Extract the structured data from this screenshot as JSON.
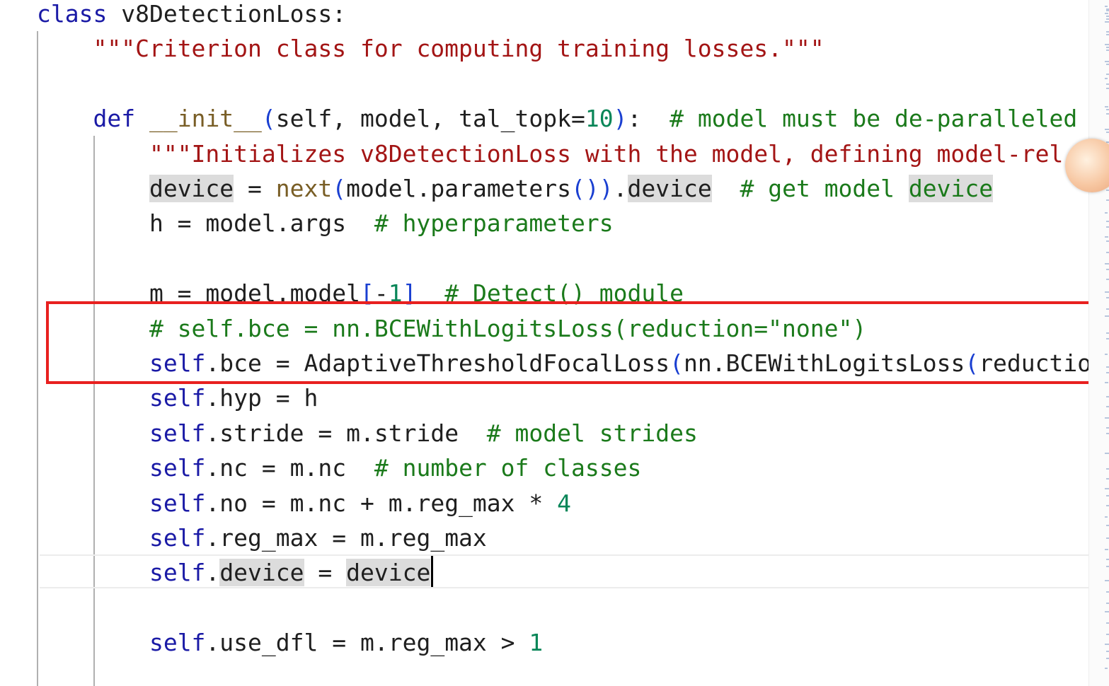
{
  "editor": {
    "lines": [
      {
        "id": "class-def",
        "tokens": [
          {
            "t": "class ",
            "c": "kw"
          },
          {
            "t": "v8DetectionLoss",
            "c": ""
          },
          {
            "t": ":",
            "c": ""
          }
        ]
      },
      {
        "id": "class-docstring",
        "tokens": [
          {
            "t": "    ",
            "c": ""
          },
          {
            "t": "\"\"\"Criterion class for computing training losses.\"\"\"",
            "c": "str"
          }
        ]
      },
      {
        "id": "blank-1",
        "tokens": []
      },
      {
        "id": "init-def",
        "tokens": [
          {
            "t": "    ",
            "c": ""
          },
          {
            "t": "def ",
            "c": "kw"
          },
          {
            "t": "__init__",
            "c": "fn"
          },
          {
            "t": "(",
            "c": "par"
          },
          {
            "t": "self, model, tal_topk=",
            "c": ""
          },
          {
            "t": "10",
            "c": "num"
          },
          {
            "t": ")",
            "c": "par"
          },
          {
            "t": ":  ",
            "c": ""
          },
          {
            "t": "# model must be de-paralleled",
            "c": "cmt"
          }
        ]
      },
      {
        "id": "init-docstring",
        "tokens": [
          {
            "t": "        ",
            "c": ""
          },
          {
            "t": "\"\"\"Initializes v8DetectionLoss with the model, defining model-rel",
            "c": "str"
          }
        ]
      },
      {
        "id": "device-assign",
        "tokens": [
          {
            "t": "        ",
            "c": ""
          },
          {
            "t": "device",
            "c": "hl"
          },
          {
            "t": " = ",
            "c": ""
          },
          {
            "t": "next",
            "c": "fn"
          },
          {
            "t": "(",
            "c": "par"
          },
          {
            "t": "model.parameters",
            "c": ""
          },
          {
            "t": "())",
            "c": "par"
          },
          {
            "t": ".",
            "c": ""
          },
          {
            "t": "device",
            "c": "hl"
          },
          {
            "t": "  ",
            "c": ""
          },
          {
            "t": "# get model ",
            "c": "cmt"
          },
          {
            "t": "device",
            "c": "cmt hl"
          }
        ]
      },
      {
        "id": "hyp-assign",
        "tokens": [
          {
            "t": "        h = model.args  ",
            "c": ""
          },
          {
            "t": "# hyperparameters",
            "c": "cmt"
          }
        ]
      },
      {
        "id": "blank-2",
        "tokens": []
      },
      {
        "id": "detect-module",
        "tokens": [
          {
            "t": "        m = model.model",
            "c": ""
          },
          {
            "t": "[",
            "c": "par"
          },
          {
            "t": "-",
            "c": ""
          },
          {
            "t": "1",
            "c": "num"
          },
          {
            "t": "]",
            "c": "par"
          },
          {
            "t": "  ",
            "c": ""
          },
          {
            "t": "# Detect() module",
            "c": "cmt"
          }
        ]
      },
      {
        "id": "bce-commented",
        "tokens": [
          {
            "t": "        ",
            "c": ""
          },
          {
            "t": "# self.bce = nn.BCEWithLogitsLoss(reduction=\"none\")",
            "c": "cmt"
          }
        ]
      },
      {
        "id": "bce-adaptive",
        "tokens": [
          {
            "t": "        ",
            "c": ""
          },
          {
            "t": "self",
            "c": "slf"
          },
          {
            "t": ".bce = AdaptiveThresholdFocalLoss",
            "c": ""
          },
          {
            "t": "(",
            "c": "par"
          },
          {
            "t": "nn.BCEWithLogitsLoss",
            "c": ""
          },
          {
            "t": "(",
            "c": "par"
          },
          {
            "t": "reductio",
            "c": ""
          }
        ]
      },
      {
        "id": "hyp-self",
        "tokens": [
          {
            "t": "        ",
            "c": ""
          },
          {
            "t": "self",
            "c": "slf"
          },
          {
            "t": ".hyp = h",
            "c": ""
          }
        ]
      },
      {
        "id": "stride",
        "tokens": [
          {
            "t": "        ",
            "c": ""
          },
          {
            "t": "self",
            "c": "slf"
          },
          {
            "t": ".stride = m.stride  ",
            "c": ""
          },
          {
            "t": "# model strides",
            "c": "cmt"
          }
        ]
      },
      {
        "id": "nc",
        "tokens": [
          {
            "t": "        ",
            "c": ""
          },
          {
            "t": "self",
            "c": "slf"
          },
          {
            "t": ".nc = m.nc  ",
            "c": ""
          },
          {
            "t": "# number of classes",
            "c": "cmt"
          }
        ]
      },
      {
        "id": "no",
        "tokens": [
          {
            "t": "        ",
            "c": ""
          },
          {
            "t": "self",
            "c": "slf"
          },
          {
            "t": ".no = m.nc + m.reg_max * ",
            "c": ""
          },
          {
            "t": "4",
            "c": "num"
          }
        ]
      },
      {
        "id": "reg-max",
        "tokens": [
          {
            "t": "        ",
            "c": ""
          },
          {
            "t": "self",
            "c": "slf"
          },
          {
            "t": ".reg_max = m.reg_max",
            "c": ""
          }
        ]
      },
      {
        "id": "device-self",
        "tokens": [
          {
            "t": "        ",
            "c": ""
          },
          {
            "t": "self",
            "c": "slf"
          },
          {
            "t": ".",
            "c": ""
          },
          {
            "t": "device",
            "c": "hl"
          },
          {
            "t": " = ",
            "c": ""
          },
          {
            "t": "device",
            "c": "hl"
          }
        ]
      },
      {
        "id": "blank-3",
        "tokens": []
      },
      {
        "id": "use-dfl",
        "tokens": [
          {
            "t": "        ",
            "c": ""
          },
          {
            "t": "self",
            "c": "slf"
          },
          {
            "t": ".use_dfl = m.reg_max > ",
            "c": ""
          },
          {
            "t": "1",
            "c": "num"
          }
        ]
      }
    ]
  },
  "colors": {
    "annotation_box": "#e8201f",
    "keyword": "#1a1aa6",
    "string": "#a31515",
    "comment": "#1b7a1b",
    "number": "#098658",
    "highlight": "#dcdcdc"
  },
  "icons": {
    "avatar": "floating-avatar-icon"
  }
}
